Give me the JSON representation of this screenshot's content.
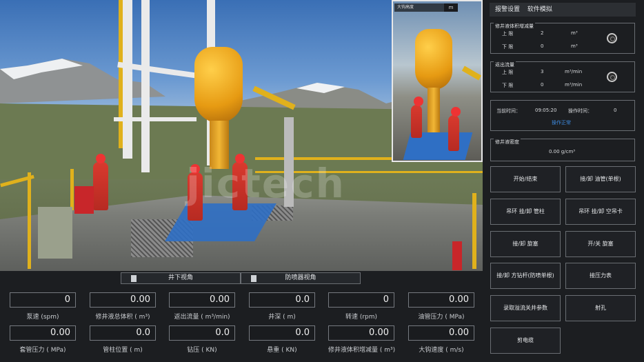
{
  "viewport": {
    "inset_camera": {
      "label": "大钩高度",
      "index": "m"
    },
    "view_tabs": [
      "井下视角",
      "防喷器视角"
    ]
  },
  "gauges": [
    {
      "value": "0",
      "label": "泵速 (spm)"
    },
    {
      "value": "0.00",
      "label": "修井液总体积 ( m³)"
    },
    {
      "value": "0.00",
      "label": "返出流量 ( m³/min)"
    },
    {
      "value": "0.0",
      "label": "井深 ( m)"
    },
    {
      "value": "0",
      "label": "转速 (rpm)"
    },
    {
      "value": "0.00",
      "label": "油管压力 ( MPa)"
    },
    {
      "value": "0.00",
      "label": "套管压力 ( MPa)"
    },
    {
      "value": "0.0",
      "label": "管柱位置 ( m)"
    },
    {
      "value": "0.0",
      "label": "钻压 ( KN)"
    },
    {
      "value": "0.0",
      "label": "悬重 ( KN)"
    },
    {
      "value": "0.00",
      "label": "修井液体积增减量 ( m³)"
    },
    {
      "value": "0.00",
      "label": "大钩速度 ( m/s)"
    }
  ],
  "panel": {
    "menu": [
      "报警设置",
      "软件模拟"
    ],
    "volume_group": {
      "title": "修井液体积增减量",
      "upper_label": "上 限",
      "upper_value": "2",
      "upper_unit": "m³",
      "lower_label": "下 限",
      "lower_value": "0",
      "lower_unit": "m³"
    },
    "flow_group": {
      "title": "返出流量",
      "upper_label": "上 限",
      "upper_value": "3",
      "upper_unit": "m³/min",
      "lower_label": "下 限",
      "lower_value": "0",
      "lower_unit": "m³/min"
    },
    "time_group": {
      "current_label": "当前时间：",
      "current_value": "09:05:20",
      "op_label": "操作时间：",
      "op_value": "0",
      "status": "操作正常"
    },
    "density_group": {
      "title": "修井液密度",
      "value": "0.00 g/cm³"
    },
    "buttons": [
      "开始/结束",
      "接/卸 油管(单根)",
      "吊环 挂/卸 管柱",
      "吊环 挂/卸 空吊卡",
      "接/卸 旋塞",
      "开/关 旋塞",
      "接/卸 方钻杆(防喷单根)",
      "接压力表",
      "录取溢流关井参数",
      "射孔",
      "剪电缆"
    ]
  },
  "colors": {
    "accent_status": "#3d8be0",
    "hook": "#f0a820",
    "worker_suit": "#d93a2e"
  }
}
